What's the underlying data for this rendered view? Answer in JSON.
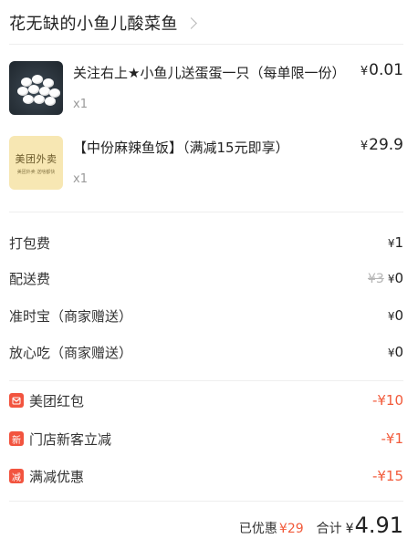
{
  "store": {
    "name": "花无缺的小鱼儿酸菜鱼"
  },
  "items": [
    {
      "name": "关注右上★小鱼儿送蛋蛋一只（每单限一份）",
      "qty": "x1",
      "currency": "¥",
      "price": "0.01",
      "thumb": "eggs-photo"
    },
    {
      "name": "【中份麻辣鱼饭】（满减15元即享）",
      "qty": "x1",
      "currency": "¥",
      "price": "29.9",
      "thumb": "meituan-placeholder",
      "thumb_title": "美团外卖",
      "thumb_sub": "美团外卖 送啥都快"
    }
  ],
  "fees": [
    {
      "label": "打包费",
      "currency": "¥",
      "value": "1"
    },
    {
      "label": "配送费",
      "original": "¥3",
      "currency": "¥",
      "value": "0"
    },
    {
      "label": "准时宝（商家赠送）",
      "currency": "¥",
      "value": "0"
    },
    {
      "label": "放心吃（商家赠送）",
      "currency": "¥",
      "value": "0"
    }
  ],
  "discounts": [
    {
      "badge": "",
      "badge_icon": "red-packet-icon",
      "label": "美团红包",
      "value": "-¥10"
    },
    {
      "badge": "新",
      "label": "门店新客立减",
      "value": "-¥1"
    },
    {
      "badge": "减",
      "label": "满减优惠",
      "value": "-¥15"
    }
  ],
  "summary": {
    "saved_label": "已优惠",
    "saved_value": "¥29",
    "total_label": "合计",
    "total_currency": "¥",
    "total_value": "4.91"
  },
  "colors": {
    "accent_red": "#f25a3a",
    "badge_red": "#f2543f",
    "thumb_yellow": "#f7e7b3"
  }
}
